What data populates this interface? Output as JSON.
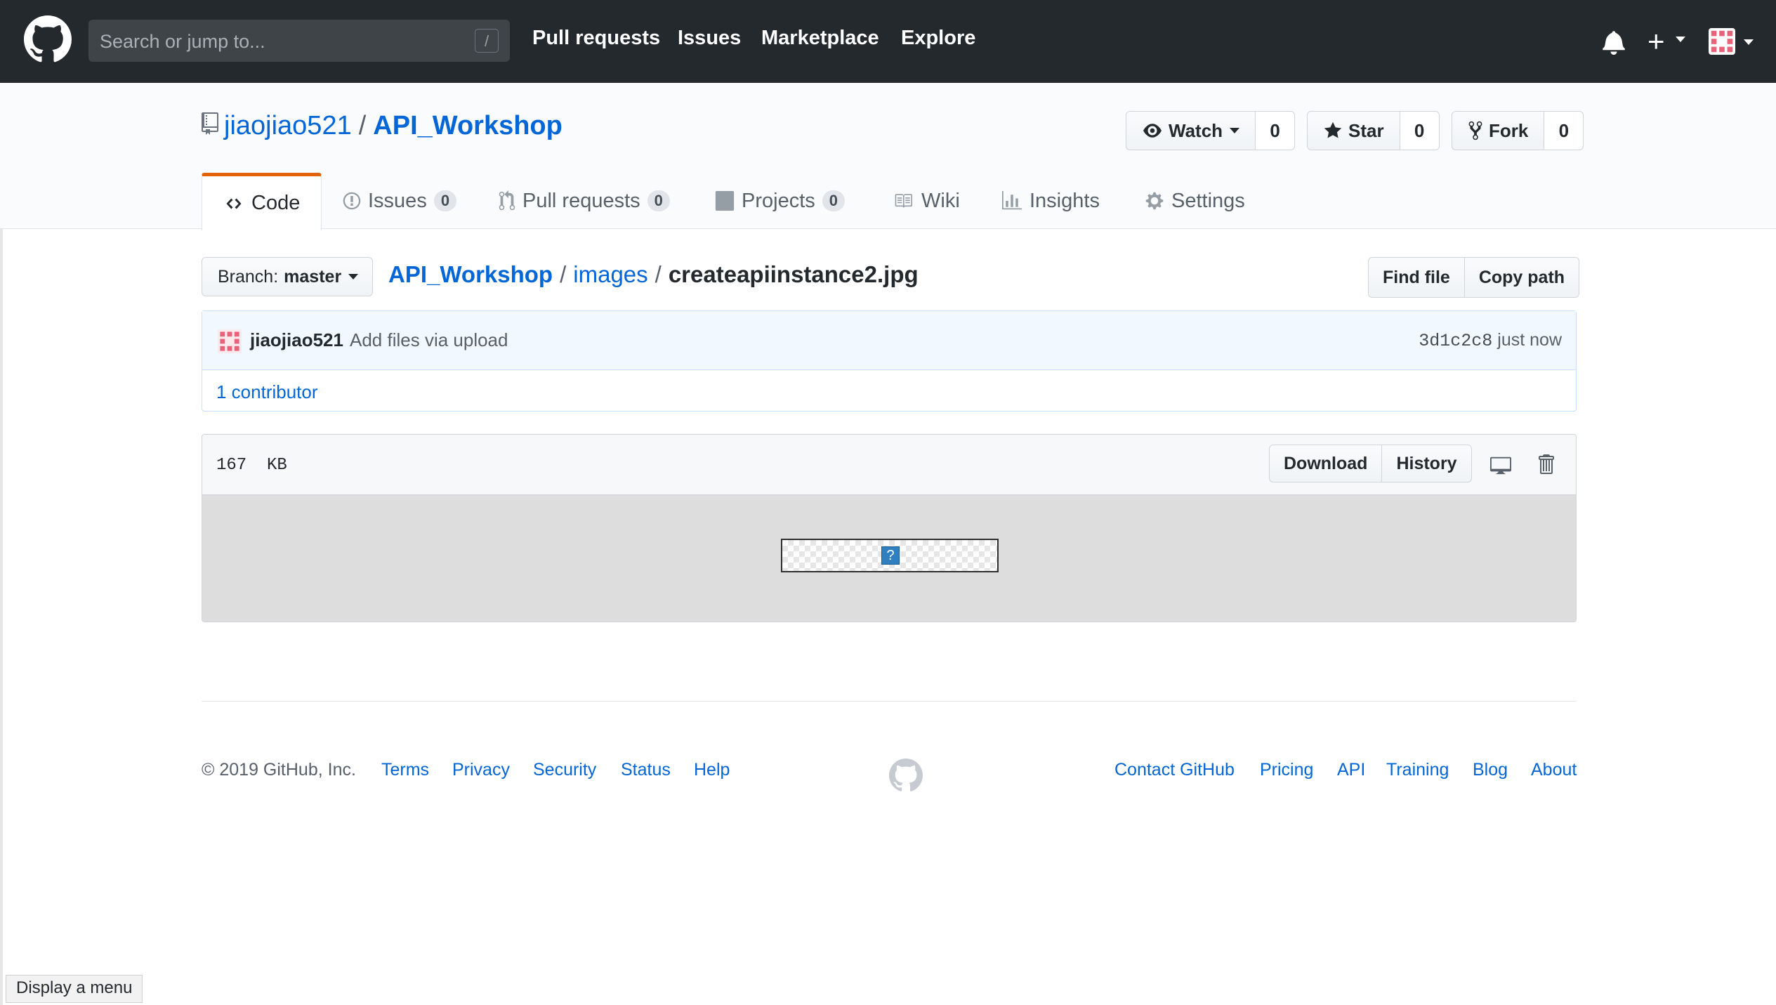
{
  "header": {
    "search_placeholder": "Search or jump to...",
    "search_shortcut": "/",
    "nav": [
      "Pull requests",
      "Issues",
      "Marketplace",
      "Explore"
    ],
    "plus_label": "+"
  },
  "repo": {
    "owner": "jiaojiao521",
    "separator": "/",
    "name": "API_Workshop",
    "watch": {
      "label": "Watch",
      "count": "0"
    },
    "star": {
      "label": "Star",
      "count": "0"
    },
    "fork": {
      "label": "Fork",
      "count": "0"
    }
  },
  "tabs": [
    {
      "label": "Code",
      "icon": "code-icon",
      "selected": true
    },
    {
      "label": "Issues",
      "icon": "issue-icon",
      "count": "0"
    },
    {
      "label": "Pull requests",
      "icon": "pull-request-icon",
      "count": "0"
    },
    {
      "label": "Projects",
      "icon": "project-icon",
      "count": "0"
    },
    {
      "label": "Wiki",
      "icon": "book-icon"
    },
    {
      "label": "Insights",
      "icon": "graph-icon"
    },
    {
      "label": "Settings",
      "icon": "gear-icon"
    }
  ],
  "file_nav": {
    "branch_label": "Branch:",
    "branch": "master",
    "crumbs": [
      "API_Workshop",
      "images"
    ],
    "sep": "/",
    "filename": "createapiinstance2.jpg",
    "find_file": "Find file",
    "copy_path": "Copy path"
  },
  "commit": {
    "author": "jiaojiao521",
    "message": "Add files via upload",
    "sha": "3d1c2c8",
    "time": "just now",
    "contributors": "1 contributor"
  },
  "file": {
    "size": "167  KB",
    "download": "Download",
    "history": "History",
    "broken_image_glyph": "?"
  },
  "footer": {
    "copyright": "© 2019 GitHub, Inc.",
    "left_links": [
      "Terms",
      "Privacy",
      "Security",
      "Status",
      "Help"
    ],
    "right_links": [
      "Contact GitHub",
      "Pricing",
      "API",
      "Training",
      "Blog",
      "About"
    ]
  },
  "status_tooltip": "Display a menu",
  "colors": {
    "header_bg": "#24292e",
    "link": "#0366d6",
    "tab_accent": "#e36209",
    "commit_bg": "#f1f8ff"
  }
}
